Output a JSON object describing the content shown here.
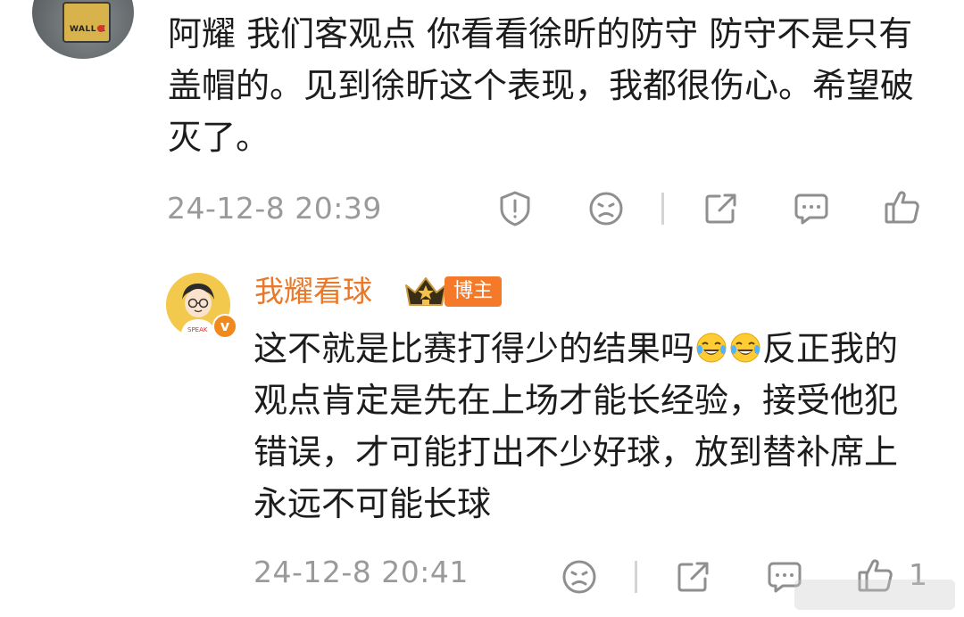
{
  "comment": {
    "text": "阿耀 我们客观点 你看看徐昕的防守 防守不是只有盖帽的。见到徐昕这个表现，我都很伤心。希望破灭了。",
    "timestamp": "24-12-8 20:39",
    "actions": [
      "report-icon",
      "dislike-icon",
      "share-icon",
      "comment-icon",
      "like-icon"
    ]
  },
  "reply": {
    "username": "我耀看球",
    "blogger_badge": "博主",
    "text_before_emoji": "这不就是比赛打得少的结果吗",
    "emoji": [
      "laugh-cry-emoji",
      "laugh-cry-emoji"
    ],
    "text_after_emoji": "反正我的观点肯定是先在上场才能长经验，接受他犯错误，才可能打出不少好球，放到替补席上永远不可能长球",
    "timestamp": "24-12-8 20:41",
    "like_count": "1",
    "actions": [
      "dislike-icon",
      "share-icon",
      "comment-icon",
      "like-icon"
    ]
  },
  "colors": {
    "username": "#e8782a",
    "badge": "#f47a2a",
    "timestamp": "#9a9a9a",
    "icon": "#8f8f8f"
  }
}
